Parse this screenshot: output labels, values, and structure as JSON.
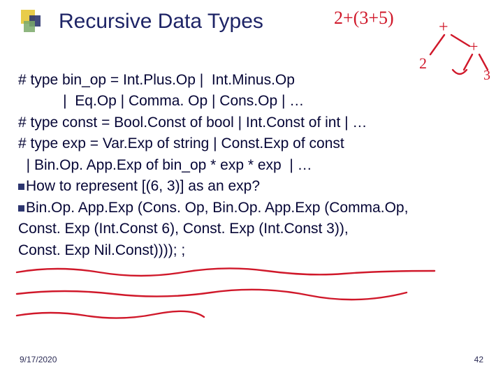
{
  "title": "Recursive Data Types",
  "lines": {
    "l1": "# type bin_op = Int.Plus.Op |  Int.Minus.Op",
    "l2": "           |  Eq.Op | Comma. Op | Cons.Op | …",
    "l3": "# type const = Bool.Const of bool | Int.Const of int | …",
    "l4": "# type exp = Var.Exp of string | Const.Exp of const",
    "l5": "  | Bin.Op. App.Exp of bin_op * exp * exp  | …",
    "l6": "How to represent [(6, 3)] as an exp?",
    "l7": "Bin.Op. App.Exp (Cons. Op, Bin.Op. App.Exp (Comma.Op,",
    "l8": "Const. Exp (Int.Const 6), Const. Exp (Int.Const 3)),",
    "l9": "Const. Exp Nil.Const)))); ;"
  },
  "footer": {
    "date": "9/17/2020",
    "page": "42"
  },
  "hand": {
    "expr": "2+(3+5)",
    "n1": "2",
    "n2": "3",
    "op1": "+",
    "op2": "+",
    "op3": "+"
  }
}
